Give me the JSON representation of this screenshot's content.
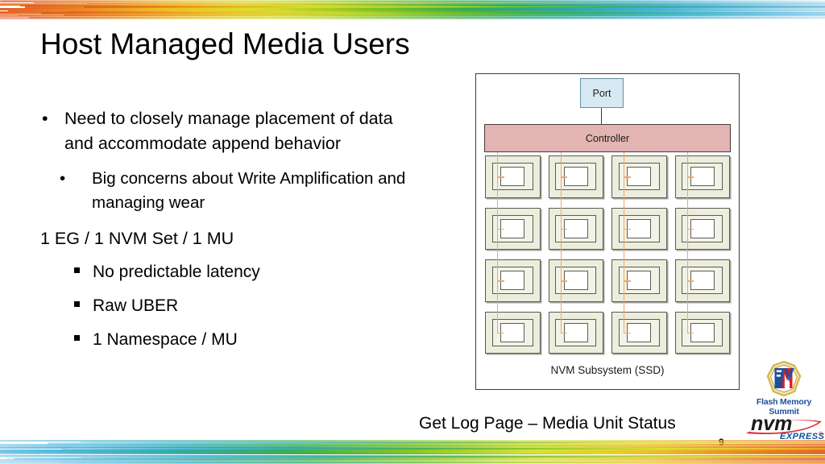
{
  "slide": {
    "title": "Host Managed Media Users",
    "page_number": "9"
  },
  "bullets": [
    {
      "level": 1,
      "marker": "•",
      "text": "Need to closely manage placement of data and accommodate append behavior"
    },
    {
      "level": 2,
      "marker": "•",
      "text": "Big concerns about Write Amplification and managing wear"
    },
    {
      "level": 0,
      "marker": "",
      "text": "1 EG / 1 NVM Set / 1 MU"
    },
    {
      "level": 3,
      "marker": "▪",
      "text": "No predictable latency"
    },
    {
      "level": 3,
      "marker": "▪",
      "text": "Raw UBER"
    },
    {
      "level": 3,
      "marker": "▪",
      "text": "1 Namespace / MU"
    }
  ],
  "diagram": {
    "port_label": "Port",
    "controller_label": "Controller",
    "subsystem_label": "NVM Subsystem (SSD)",
    "caption": "Get Log Page – Media Unit Status",
    "grid": {
      "rows": 4,
      "columns": 4,
      "total_media_units": 16
    },
    "colors": {
      "port_fill": "#d7e9f2",
      "port_border": "#68909f",
      "controller_fill": "#e2b4b2",
      "controller_border": "#4a3c3c",
      "media_unit_fill": "#eceddc",
      "media_unit_border": "#585a4e",
      "media_unit_inner_fill": "#ffffff",
      "trace_line": "#f2a868",
      "outer_border": "#3b3b3b"
    }
  },
  "logos": {
    "fms": {
      "mark_left_letter": "F",
      "mark_right_letter": "M",
      "name": "Flash Memory Summit",
      "blue": "#1b4f9c",
      "red": "#d81f26",
      "gold": "#d9b54a"
    },
    "nvme": {
      "wordmark": "nvm",
      "subtext": "EXPRESS",
      "registered": "®",
      "dark": "#1a1a1a",
      "red": "#d5202a",
      "blue": "#0b4fa0"
    }
  },
  "decor": {
    "top_band_colors": [
      "#e04a1f",
      "#e8791c",
      "#efc020",
      "#d7e02a",
      "#86c520",
      "#35ac4a",
      "#2aa9a0",
      "#4cb6dd",
      "#9fd4ec",
      "#d9eef8"
    ],
    "bottom_band_colors": [
      "#9fd4ec",
      "#4cb6dd",
      "#2aa9a0",
      "#35ac4a",
      "#86c520",
      "#d7e02a",
      "#efc020",
      "#e8791c",
      "#e04a1f"
    ]
  }
}
